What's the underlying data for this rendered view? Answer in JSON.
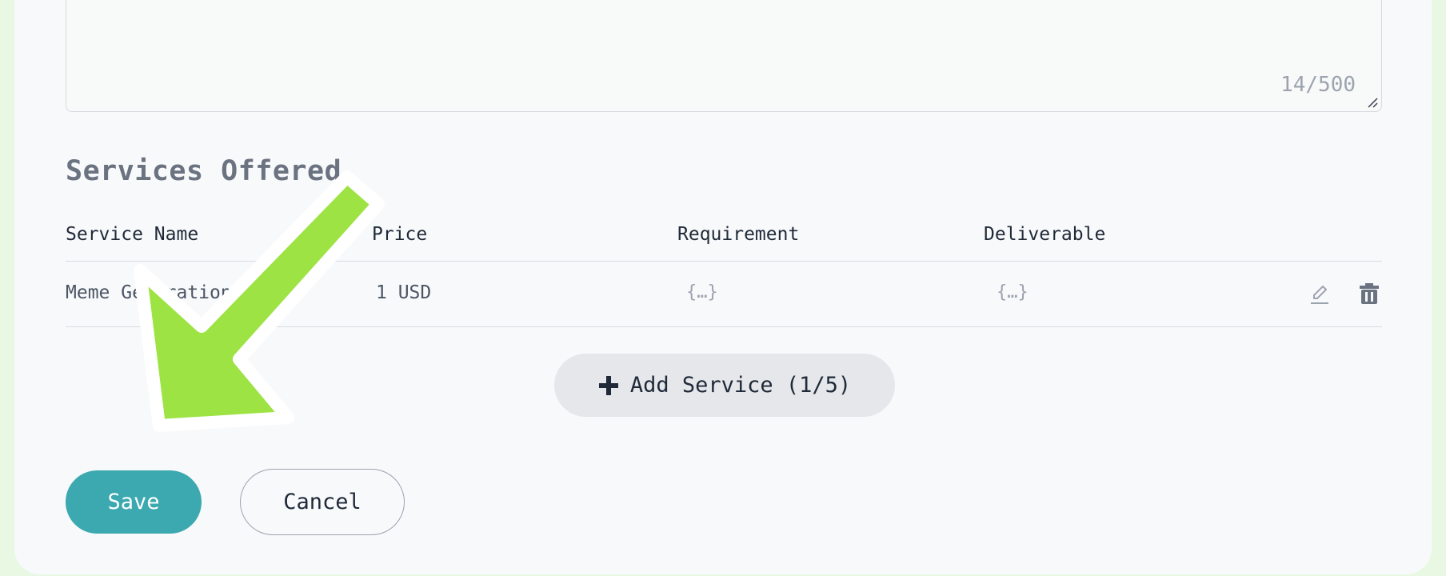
{
  "description_field": {
    "char_counter": "14/500"
  },
  "services": {
    "title": "Services Offered",
    "columns": [
      "Service Name",
      "Price",
      "Requirement",
      "Deliverable"
    ],
    "rows": [
      {
        "name": "Meme Generation",
        "price": "1 USD",
        "requirement": "{…}",
        "deliverable": "{…}"
      }
    ],
    "add_button_label": "Add Service (1/5)"
  },
  "actions": {
    "save_label": "Save",
    "cancel_label": "Cancel"
  },
  "icons": {
    "add": "plus-icon",
    "edit": "pencil-icon",
    "delete": "trash-icon",
    "annotation": "arrow-icon"
  },
  "colors": {
    "accent": "#3ba9af",
    "annotation": "#9de344",
    "page_background": "#e9f8e3"
  }
}
